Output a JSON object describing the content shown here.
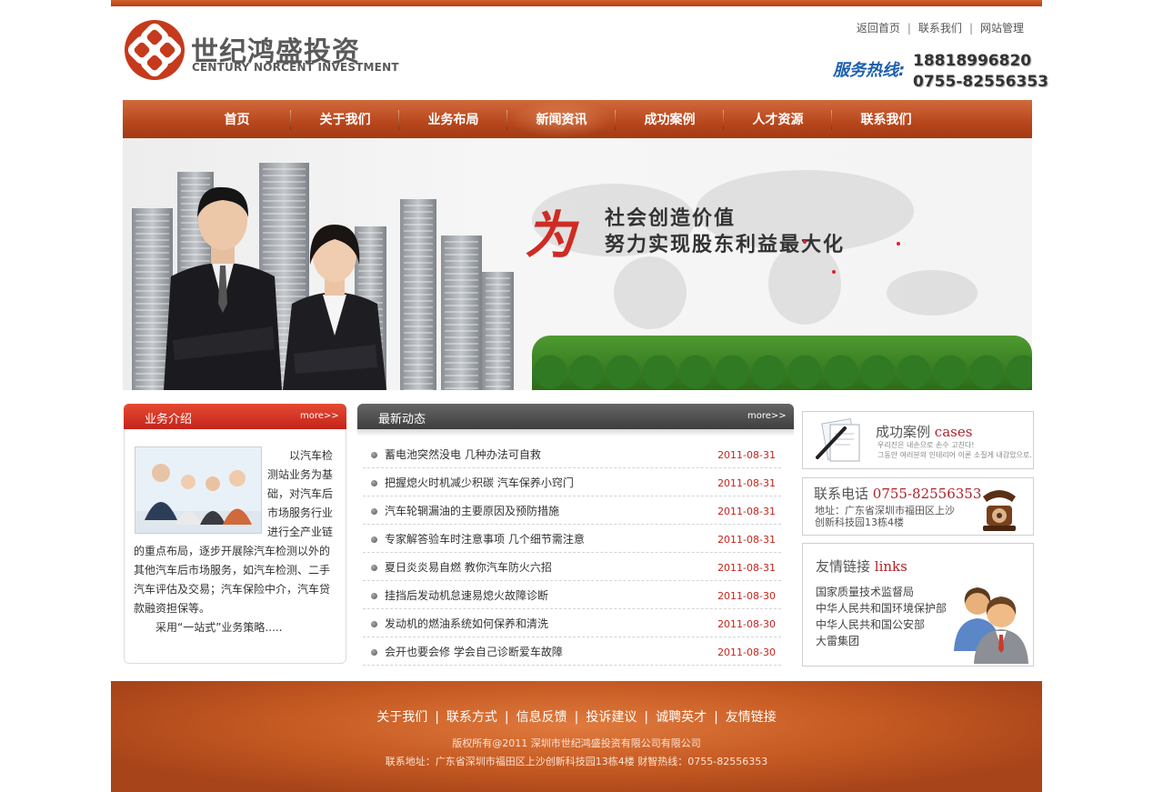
{
  "brand": {
    "name_cn": "世纪鸿盛投资",
    "name_en": "CENTURY NORCENT INVESTMENT",
    "primary_color": "#c4241b",
    "accent_color": "#b8461c"
  },
  "top_links": [
    "返回首页",
    "联系我们",
    "网站管理"
  ],
  "hotline": {
    "label": "服务热线:",
    "phones": [
      "18818996820",
      "0755-82556353"
    ]
  },
  "nav": [
    "首页",
    "关于我们",
    "业务布局",
    "新闻资讯",
    "成功案例",
    "人才资源",
    "联系我们"
  ],
  "banner": {
    "mark": "为",
    "line1": "社会创造价值",
    "line2": "努力实现股东利益最大化"
  },
  "business_intro": {
    "title": "业务介绍",
    "more": "more>>",
    "paragraph1": "以汽车检测站业务为基础，对汽车后市场服务行业进行全产业链的重点布局，逐步开展除汽车检测以外的其他汽车后市场服务，如汽车检测、二手汽车评估及交易；汽车保险中介，汽车贷款融资担保等。",
    "paragraph2": "采用“一站式”业务策略....."
  },
  "news": {
    "title": "最新动态",
    "more": "more>>",
    "items": [
      {
        "title": "蓄电池突然没电 几种办法可自救",
        "date": "2011-08-31"
      },
      {
        "title": "把握熄火时机减少积碳 汽车保养小窍门",
        "date": "2011-08-31"
      },
      {
        "title": "汽车轮辋漏油的主要原因及预防措施",
        "date": "2011-08-31"
      },
      {
        "title": "专家解答验车时注意事项 几个细节需注意",
        "date": "2011-08-31"
      },
      {
        "title": "夏日炎炎易自燃 教你汽车防火六招",
        "date": "2011-08-31"
      },
      {
        "title": "挂挡后发动机怠速易熄火故障诊断",
        "date": "2011-08-30"
      },
      {
        "title": "发动机的燃油系统如何保养和清洗",
        "date": "2011-08-30"
      },
      {
        "title": "会开也要会修 学会自己诊断爱车故障",
        "date": "2011-08-30"
      }
    ]
  },
  "cases": {
    "title_cn": "成功案例",
    "title_en": "cases",
    "small1": "우리진은 내손으로 손수 고친다!",
    "small2": "그동안 여러분의 인테리어 이론 소질게 내감았으로."
  },
  "contact": {
    "title": "联系电话",
    "phone": "0755-82556353",
    "address1": "地址：广东省深圳市福田区上沙",
    "address2": "创新科技园13栋4楼"
  },
  "friend_links": {
    "title_cn": "友情链接",
    "title_en": "links",
    "items": [
      "国家质量技术监督局",
      "中华人民共和国环境保护部",
      "中华人民共和国公安部",
      "大雷集团"
    ]
  },
  "footer": {
    "nav": [
      "关于我们",
      "联系方式",
      "信息反馈",
      "投诉建议",
      "诚聘英才",
      "友情链接"
    ],
    "copyright": "版权所有@2011  深圳市世纪鸿盛投资有限公司有限公司",
    "address": "联系地址：广东省深圳市福田区上沙创新科技园13栋4楼    财智热线：0755-82556353"
  }
}
